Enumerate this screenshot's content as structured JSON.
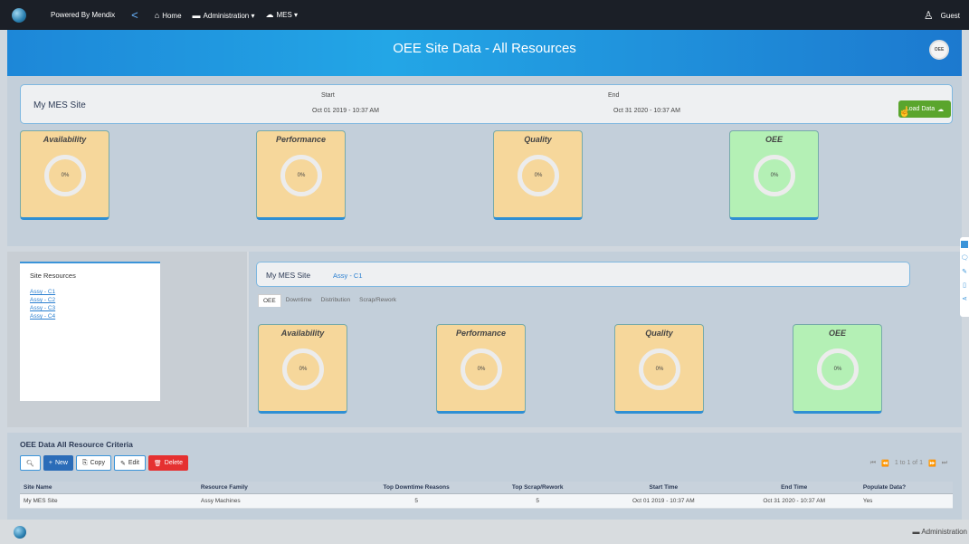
{
  "topbar": {
    "powered_by": "Powered By Mendix",
    "back": "<",
    "nav": [
      {
        "label": "Home",
        "icon": "home-icon"
      },
      {
        "label": "Administration ▾",
        "icon": "admin-icon"
      },
      {
        "label": "MES ▾",
        "icon": "cloud-icon"
      }
    ],
    "user": "Guest"
  },
  "header": {
    "title": "OEE Site Data - All Resources",
    "badge": "OEE"
  },
  "site": {
    "name": "My MES Site",
    "start_label": "Start",
    "start_value": "Oct 01 2019 - 10:37 AM",
    "end_label": "End",
    "end_value": "Oct 31 2020 - 10:37 AM",
    "load_button": "Load Data"
  },
  "site_tiles": [
    {
      "title": "Availability",
      "value": "0%"
    },
    {
      "title": "Performance",
      "value": "0%"
    },
    {
      "title": "Quality",
      "value": "0%"
    },
    {
      "title": "OEE",
      "value": "0%"
    }
  ],
  "resources": {
    "heading": "Site Resources",
    "items": [
      "Assy - C1",
      "Assy - C2",
      "Assy - C3",
      "Assy - C4"
    ]
  },
  "resource_detail": {
    "site": "My MES Site",
    "resource": "Assy - C1",
    "tabs": [
      "OEE",
      "Downtime",
      "Distribution",
      "Scrap/Rework"
    ],
    "tiles": [
      {
        "title": "Availability",
        "value": "0%"
      },
      {
        "title": "Performance",
        "value": "0%"
      },
      {
        "title": "Quality",
        "value": "0%"
      },
      {
        "title": "OEE",
        "value": "0%"
      }
    ]
  },
  "criteria": {
    "heading": "OEE Data All Resource Criteria",
    "buttons": {
      "new": "New",
      "copy": "Copy",
      "edit": "Edit",
      "delete": "Delete"
    },
    "pager": "1 to 1 of 1",
    "columns": [
      "Site Name",
      "Resource Family",
      "Top Downtime Reasons",
      "Top Scrap/Rework",
      "Start Time",
      "End Time",
      "Populate Data?"
    ],
    "rows": [
      [
        "My MES Site",
        "Assy Machines",
        "5",
        "5",
        "Oct 01 2019 - 10:37 AM",
        "Oct 31 2020 - 10:37 AM",
        "Yes"
      ]
    ]
  },
  "footer": {
    "admin": "Administration"
  }
}
